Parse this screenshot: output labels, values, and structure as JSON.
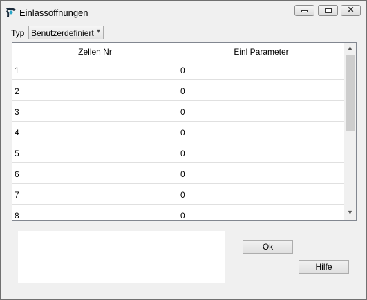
{
  "window": {
    "title": "Einlassöffnungen",
    "app_icon": "app-logo-icon"
  },
  "titlebar_buttons": {
    "minimize": "minimize-icon",
    "maximize": "maximize-icon",
    "close": "close-icon",
    "close_glyph": "✕"
  },
  "typ": {
    "label": "Typ",
    "value": "Benutzerdefiniert",
    "arrow": "▾"
  },
  "grid": {
    "columns": [
      "Zellen Nr",
      "Einl Parameter"
    ],
    "rows": [
      [
        "1",
        "0"
      ],
      [
        "2",
        "0"
      ],
      [
        "3",
        "0"
      ],
      [
        "4",
        "0"
      ],
      [
        "5",
        "0"
      ],
      [
        "6",
        "0"
      ],
      [
        "7",
        "0"
      ],
      [
        "8",
        "0"
      ]
    ],
    "scroll_up": "▲",
    "scroll_down": "▼"
  },
  "buttons": {
    "ok": "Ok",
    "help": "Hilfe"
  }
}
